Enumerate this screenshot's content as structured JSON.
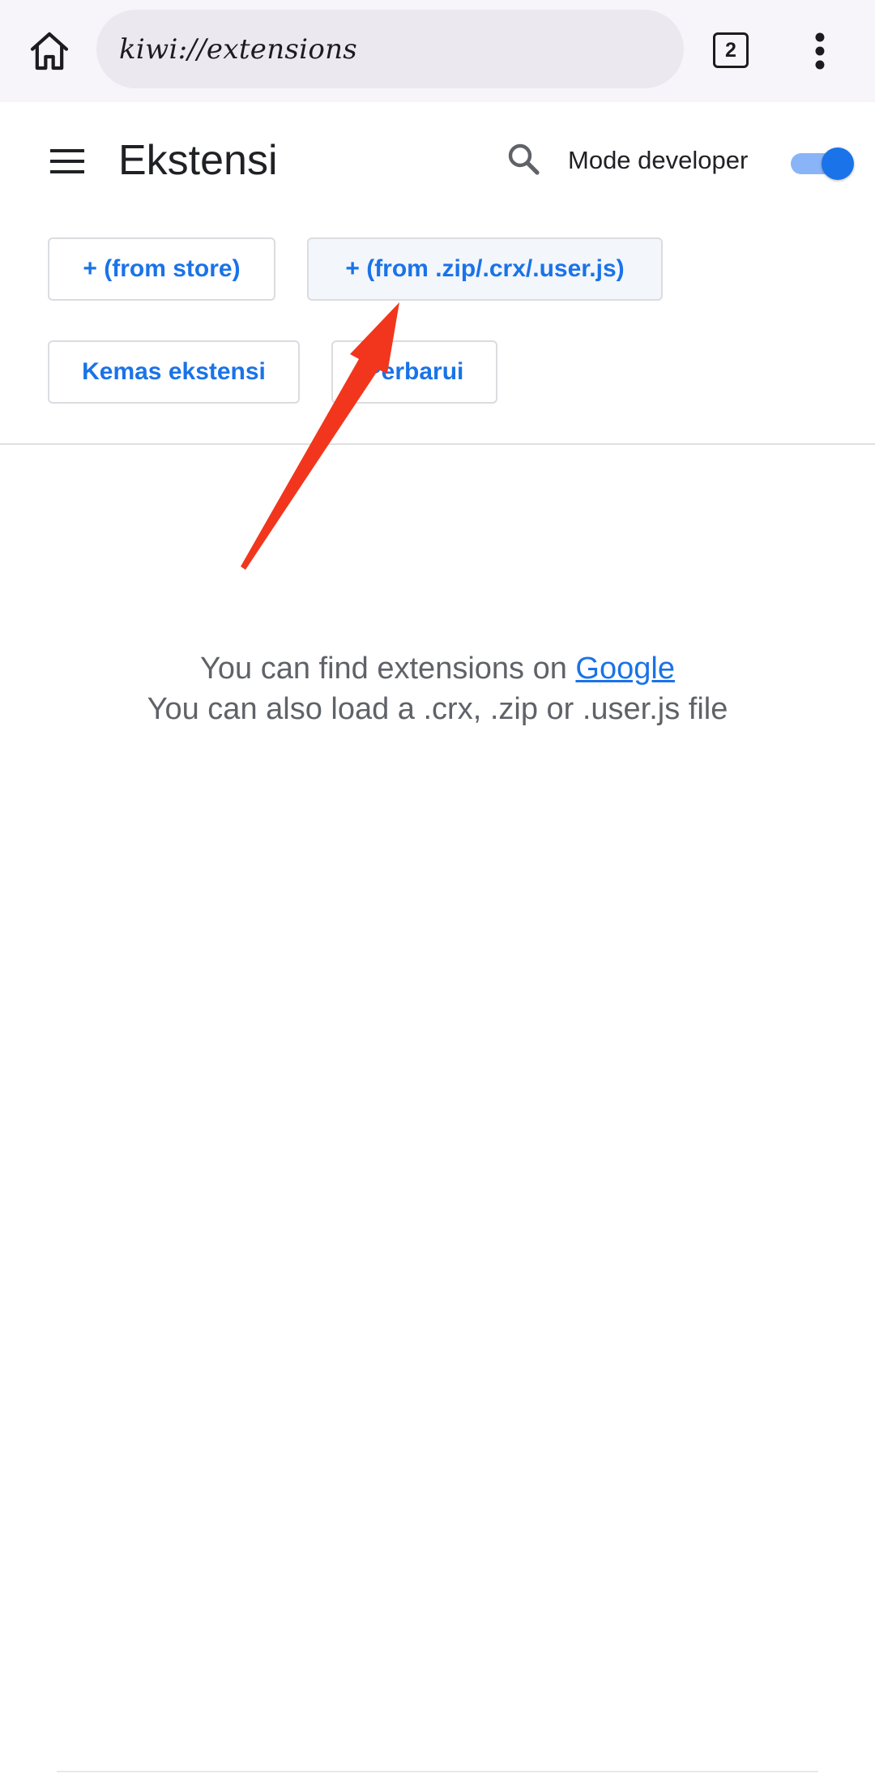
{
  "toolbar": {
    "url": "kiwi://extensions",
    "tab_count": "2",
    "icons": [
      "home-icon",
      "tab-switcher-icon",
      "more-vert-icon"
    ]
  },
  "header": {
    "title": "Ekstensi",
    "developer_mode_label": "Mode developer",
    "developer_mode_on": true,
    "icons": [
      "menu-icon",
      "search-icon"
    ]
  },
  "actions": {
    "from_store": "+ (from store)",
    "from_file": "+ (from .zip/.crx/.user.js)",
    "pack": "Kemas ekstensi",
    "update": "Perbarui"
  },
  "empty": {
    "line1_prefix": "You can find extensions on ",
    "line1_link": "Google",
    "line2": "You can also load a .crx, .zip or .user.js file"
  },
  "colors": {
    "accent": "#1a73e8",
    "annotation_arrow": "#f2361d"
  }
}
